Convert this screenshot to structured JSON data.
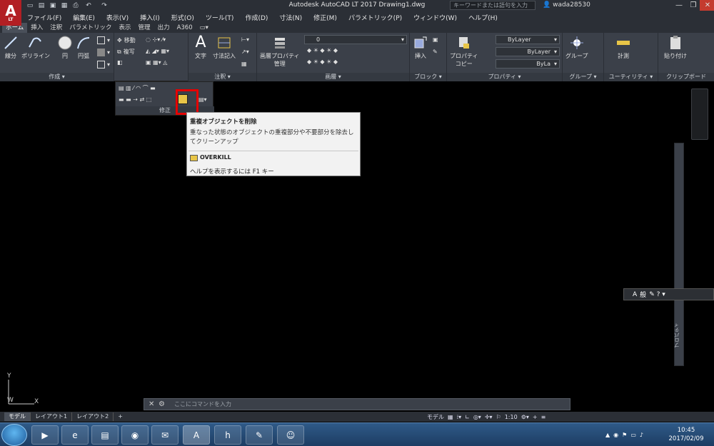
{
  "window": {
    "title": "Autodesk AutoCAD LT 2017    Drawing1.dwg",
    "search_placeholder": "キーワードまたは語句を入力",
    "user": "wada28530"
  },
  "app_logo": {
    "letter": "A",
    "sub": "LT"
  },
  "menu": [
    "ファイル(F)",
    "編集(E)",
    "表示(V)",
    "挿入(I)",
    "形式(O)",
    "ツール(T)",
    "作成(D)",
    "寸法(N)",
    "修正(M)",
    "パラメトリック(P)",
    "ウィンドウ(W)",
    "ヘルプ(H)"
  ],
  "ribbon_tabs": [
    "ホーム",
    "挿入",
    "注釈",
    "パラメトリック",
    "表示",
    "管理",
    "出力",
    "A360"
  ],
  "panels": {
    "draw": {
      "label": "作成 ▾",
      "buttons": [
        "線分",
        "ポリライン",
        "円",
        "円弧"
      ]
    },
    "modify": {
      "move": "移動",
      "copy": "複写"
    },
    "annotation": {
      "label": "注釈 ▾",
      "buttons": [
        "文字",
        "寸法記入"
      ]
    },
    "layers": {
      "label": "画層 ▾",
      "button": "画層プロパティ\n管理",
      "current": "0"
    },
    "block": {
      "label": "ブロック ▾",
      "button": "挿入"
    },
    "properties": {
      "label": "プロパティ ▾",
      "button": "プロパティ\nコピー",
      "color": "ByLayer",
      "linetype": "ByLayer",
      "lineweight": "ByLa"
    },
    "groups": {
      "label": "グループ ▾",
      "button": "グループ"
    },
    "utilities": {
      "label": "ユーティリティ ▾",
      "button": "計測"
    },
    "clipboard": {
      "label": "クリップボード",
      "button": "貼り付け"
    }
  },
  "flyout": {
    "label": "修正"
  },
  "tooltip": {
    "title": "重複オブジェクトを削除",
    "desc": "重なった状態のオブジェクトの重複部分や不要部分を除去してクリーンアップ",
    "command": "OVERKILL",
    "help": "ヘルプを表示するには F1 キー"
  },
  "props_palette_label": "プロパティ",
  "ime": {
    "mode": "A",
    "label": "般"
  },
  "command_line": {
    "placeholder": "ここにコマンドを入力"
  },
  "layout_tabs": [
    "モデル",
    "レイアウト1",
    "レイアウト2",
    "+"
  ],
  "status": {
    "model": "モデル",
    "scale": "1:10"
  },
  "ucs": {
    "y": "Y",
    "w": "W",
    "x": "X"
  },
  "taskbar": {
    "time": "10:45",
    "date": "2017/02/09"
  },
  "colors": {
    "accent": "#b21f24",
    "highlight": "#e50000",
    "ribbon": "#3b4049"
  }
}
